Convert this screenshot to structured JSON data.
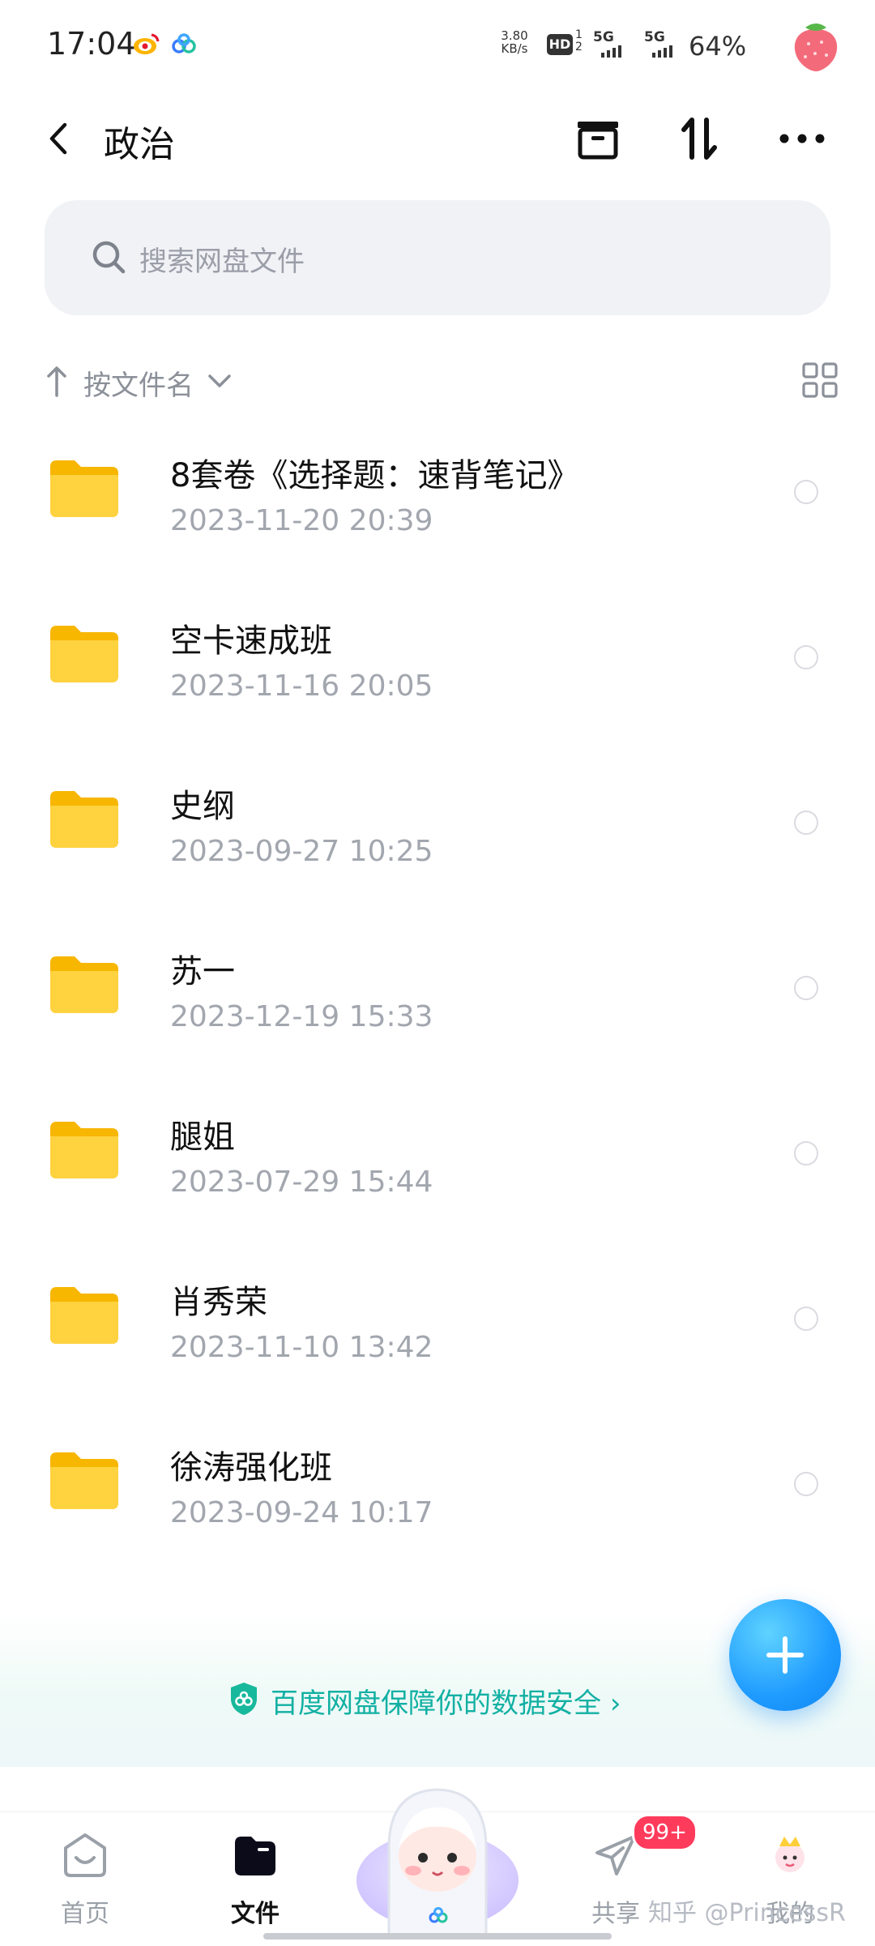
{
  "status_bar": {
    "time": "17:04",
    "net_speed_value": "3.80",
    "net_speed_unit": "KB/s",
    "hd_label": "HD",
    "sim_sup": "1 2",
    "sig1_label": "5G",
    "sig2_label": "5G",
    "battery": "64%"
  },
  "header": {
    "title": "政治"
  },
  "search": {
    "placeholder": "搜索网盘文件"
  },
  "sort": {
    "label": "按文件名"
  },
  "files": [
    {
      "name": "8套卷《选择题：速背笔记》",
      "date": "2023-11-20  20:39"
    },
    {
      "name": "空卡速成班",
      "date": "2023-11-16  20:05"
    },
    {
      "name": "史纲",
      "date": "2023-09-27  10:25"
    },
    {
      "name": "苏一",
      "date": "2023-12-19  15:33"
    },
    {
      "name": "腿姐",
      "date": "2023-07-29  15:44"
    },
    {
      "name": "肖秀荣",
      "date": "2023-11-10  13:42"
    },
    {
      "name": "徐涛强化班",
      "date": "2023-09-24  10:17"
    }
  ],
  "safety_banner": {
    "text": "百度网盘保障你的数据安全"
  },
  "nav": {
    "home": "首页",
    "files": "文件",
    "share": "共享",
    "mine": "我的",
    "share_badge": "99+"
  },
  "watermark": "知乎 @PrincessR",
  "colors": {
    "accent": "#1f9bff",
    "safety": "#12b0a3",
    "folder": "#ffcf3a",
    "badge": "#ff3b5c"
  }
}
